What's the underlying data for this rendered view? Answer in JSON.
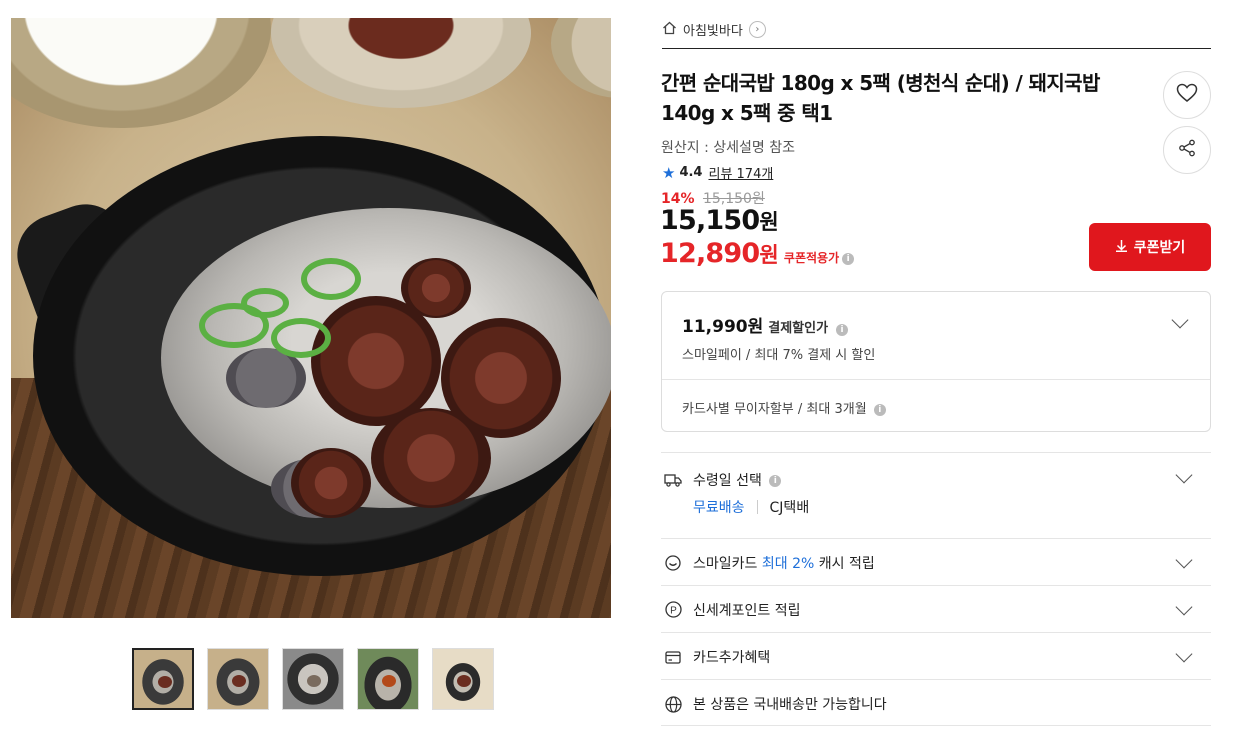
{
  "seller": {
    "name": "아침빛바다"
  },
  "product": {
    "title": "간편 순대국밥 180g x 5팩 (병천식 순대) / 돼지국밥 140g x 5팩 중 택1",
    "origin": "원산지 : 상세설명 참조",
    "rating": "4.4",
    "review_label": "리뷰 174개"
  },
  "pricing": {
    "discount_pct": "14%",
    "original_price": "15,150원",
    "price_num": "15,150",
    "price_unit": "원",
    "coupon_price_num": "12,890",
    "coupon_price_unit": "원",
    "coupon_label": "쿠폰적용가",
    "coupon_button": "쿠폰받기"
  },
  "payment": {
    "amount": "11,990원",
    "amount_label": "결제할인가",
    "smilepay": "스마일페이 / 최대 7% 결제 시 할인",
    "card_installment": "카드사별 무이자할부 / 최대 3개월"
  },
  "shipping": {
    "title": "수령일 선택",
    "free": "무료배송",
    "carrier": "CJ택배"
  },
  "benefits": {
    "smilecard_prefix": "스마일카드",
    "smilecard_highlight": "최대 2%",
    "smilecard_suffix": "캐시 적립",
    "shinsegae": "신세계포인트 적립",
    "card_extra": "카드추가혜택",
    "domestic": "본 상품은 국내배송만 가능합니다"
  },
  "icons": {
    "home": "home-icon",
    "heart": "heart-icon",
    "share": "share-icon",
    "star": "star-icon",
    "truck": "truck-icon",
    "smile": "smile-icon",
    "point": "point-icon",
    "card": "card-icon",
    "globe": "globe-icon"
  },
  "colors": {
    "accent_red": "#e0171d",
    "link_blue": "#1e6fd9"
  }
}
